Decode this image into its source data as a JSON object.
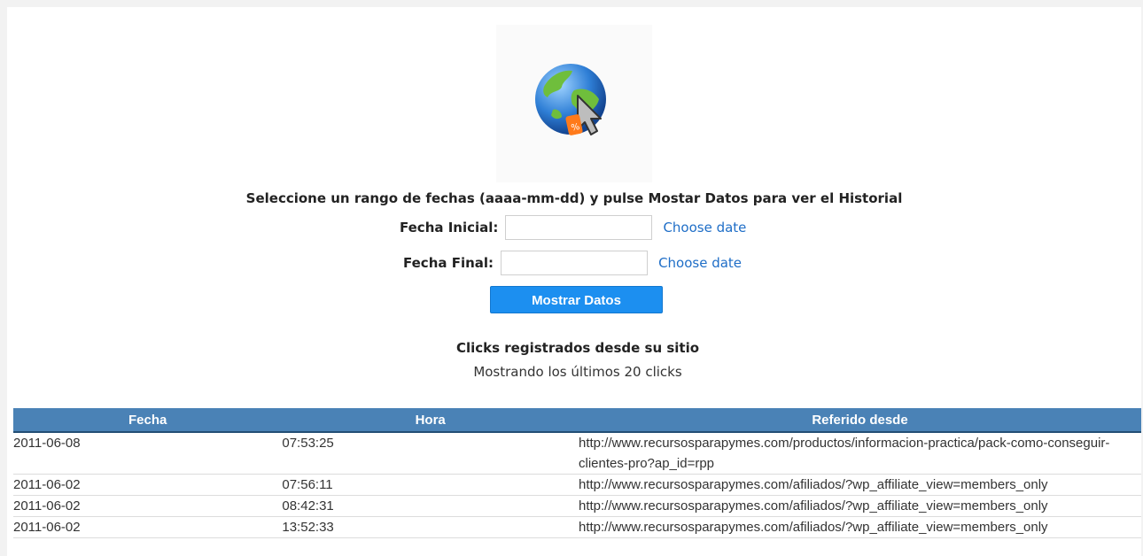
{
  "instructions": "Seleccione un rango de fechas (aaaa-mm-dd) y pulse Mostar Datos para ver el Historial",
  "form": {
    "fecha_inicial_label": "Fecha Inicial:",
    "fecha_inicial_value": "",
    "fecha_final_label": "Fecha Final:",
    "fecha_final_value": "",
    "choose_date_label": "Choose date",
    "submit_label": "Mostrar Datos"
  },
  "clicks": {
    "title": "Clicks registrados desde su sitio",
    "subtitle": "Mostrando los últimos 20 clicks"
  },
  "table": {
    "headers": [
      "Fecha",
      "Hora",
      "Referido desde"
    ],
    "rows": [
      [
        "2011-06-08",
        "07:53:25",
        "http://www.recursosparapymes.com/productos/informacion-practica/pack-como-conseguir-clientes-pro?ap_id=rpp"
      ],
      [
        "2011-06-02",
        "07:56:11",
        "http://www.recursosparapymes.com/afiliados/?wp_affiliate_view=members_only"
      ],
      [
        "2011-06-02",
        "08:42:31",
        "http://www.recursosparapymes.com/afiliados/?wp_affiliate_view=members_only"
      ],
      [
        "2011-06-02",
        "13:52:33",
        "http://www.recursosparapymes.com/afiliados/?wp_affiliate_view=members_only"
      ]
    ]
  },
  "icons": {
    "logo": "globe-cursor-discount-tag-icon"
  },
  "colors": {
    "header_bg": "#4a82b6",
    "button_bg": "#1c8ff0",
    "link": "#1f6ec7"
  }
}
